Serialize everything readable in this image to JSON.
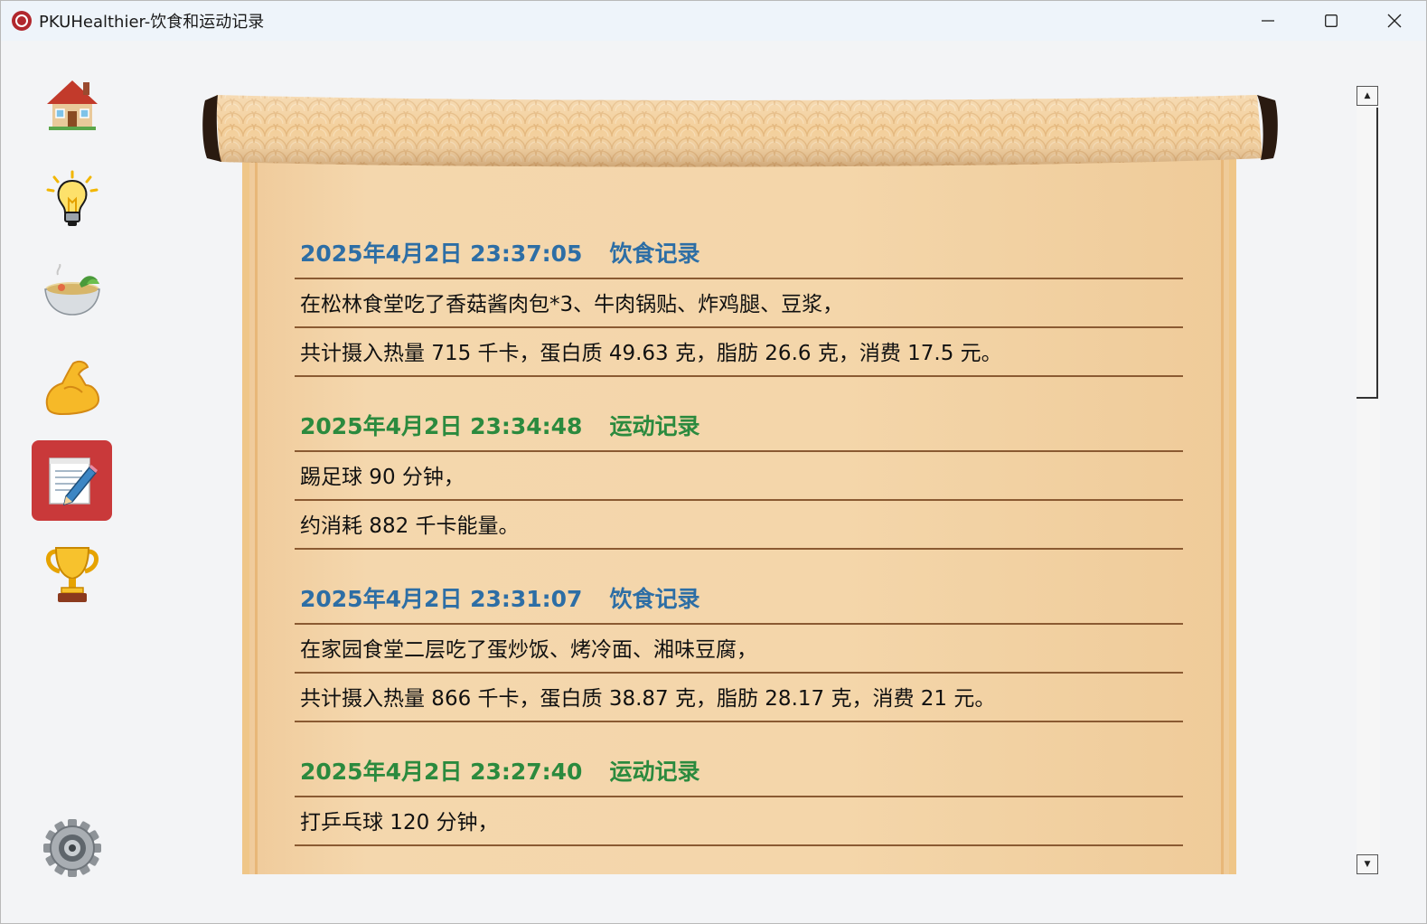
{
  "window": {
    "title": "PKUHealthier-饮食和运动记录",
    "controls": {
      "minimize": "minimize-icon",
      "maximize": "maximize-icon",
      "close": "close-icon"
    }
  },
  "sidebar": {
    "items": [
      {
        "id": "home",
        "icon": "house-icon",
        "active": false
      },
      {
        "id": "tips",
        "icon": "lightbulb-icon",
        "active": false
      },
      {
        "id": "diet",
        "icon": "soup-bowl-icon",
        "active": false
      },
      {
        "id": "exercise",
        "icon": "flexed-biceps-icon",
        "active": false
      },
      {
        "id": "records",
        "icon": "memo-pencil-icon",
        "active": true
      },
      {
        "id": "achievements",
        "icon": "trophy-icon",
        "active": false
      }
    ],
    "settings": {
      "icon": "gear-icon"
    },
    "active_color": "#c9393a"
  },
  "colors": {
    "diet": "#2d6ea5",
    "exercise": "#2b8a3e",
    "rule": "#8a5a32",
    "paper": "#f4d6aa"
  },
  "records": [
    {
      "type": "diet",
      "timestamp": "2025年4月2日 23:37:05",
      "label": "饮食记录",
      "line1": "在松林食堂吃了香菇酱肉包*3、牛肉锅贴、炸鸡腿、豆浆，",
      "line2": "共计摄入热量 715 千卡，蛋白质 49.63 克，脂肪 26.6 克，消费 17.5 元。"
    },
    {
      "type": "exercise",
      "timestamp": "2025年4月2日 23:34:48",
      "label": "运动记录",
      "line1": "踢足球 90 分钟，",
      "line2": "约消耗 882 千卡能量。"
    },
    {
      "type": "diet",
      "timestamp": "2025年4月2日 23:31:07",
      "label": "饮食记录",
      "line1": "在家园食堂二层吃了蛋炒饭、烤冷面、湘味豆腐，",
      "line2": "共计摄入热量 866 千卡，蛋白质 38.87 克，脂肪 28.17 克，消费 21 元。"
    },
    {
      "type": "exercise",
      "timestamp": "2025年4月2日 23:27:40",
      "label": "运动记录",
      "line1": "打乒乓球 120 分钟，"
    }
  ],
  "scrollbar": {
    "position": 0.0
  }
}
